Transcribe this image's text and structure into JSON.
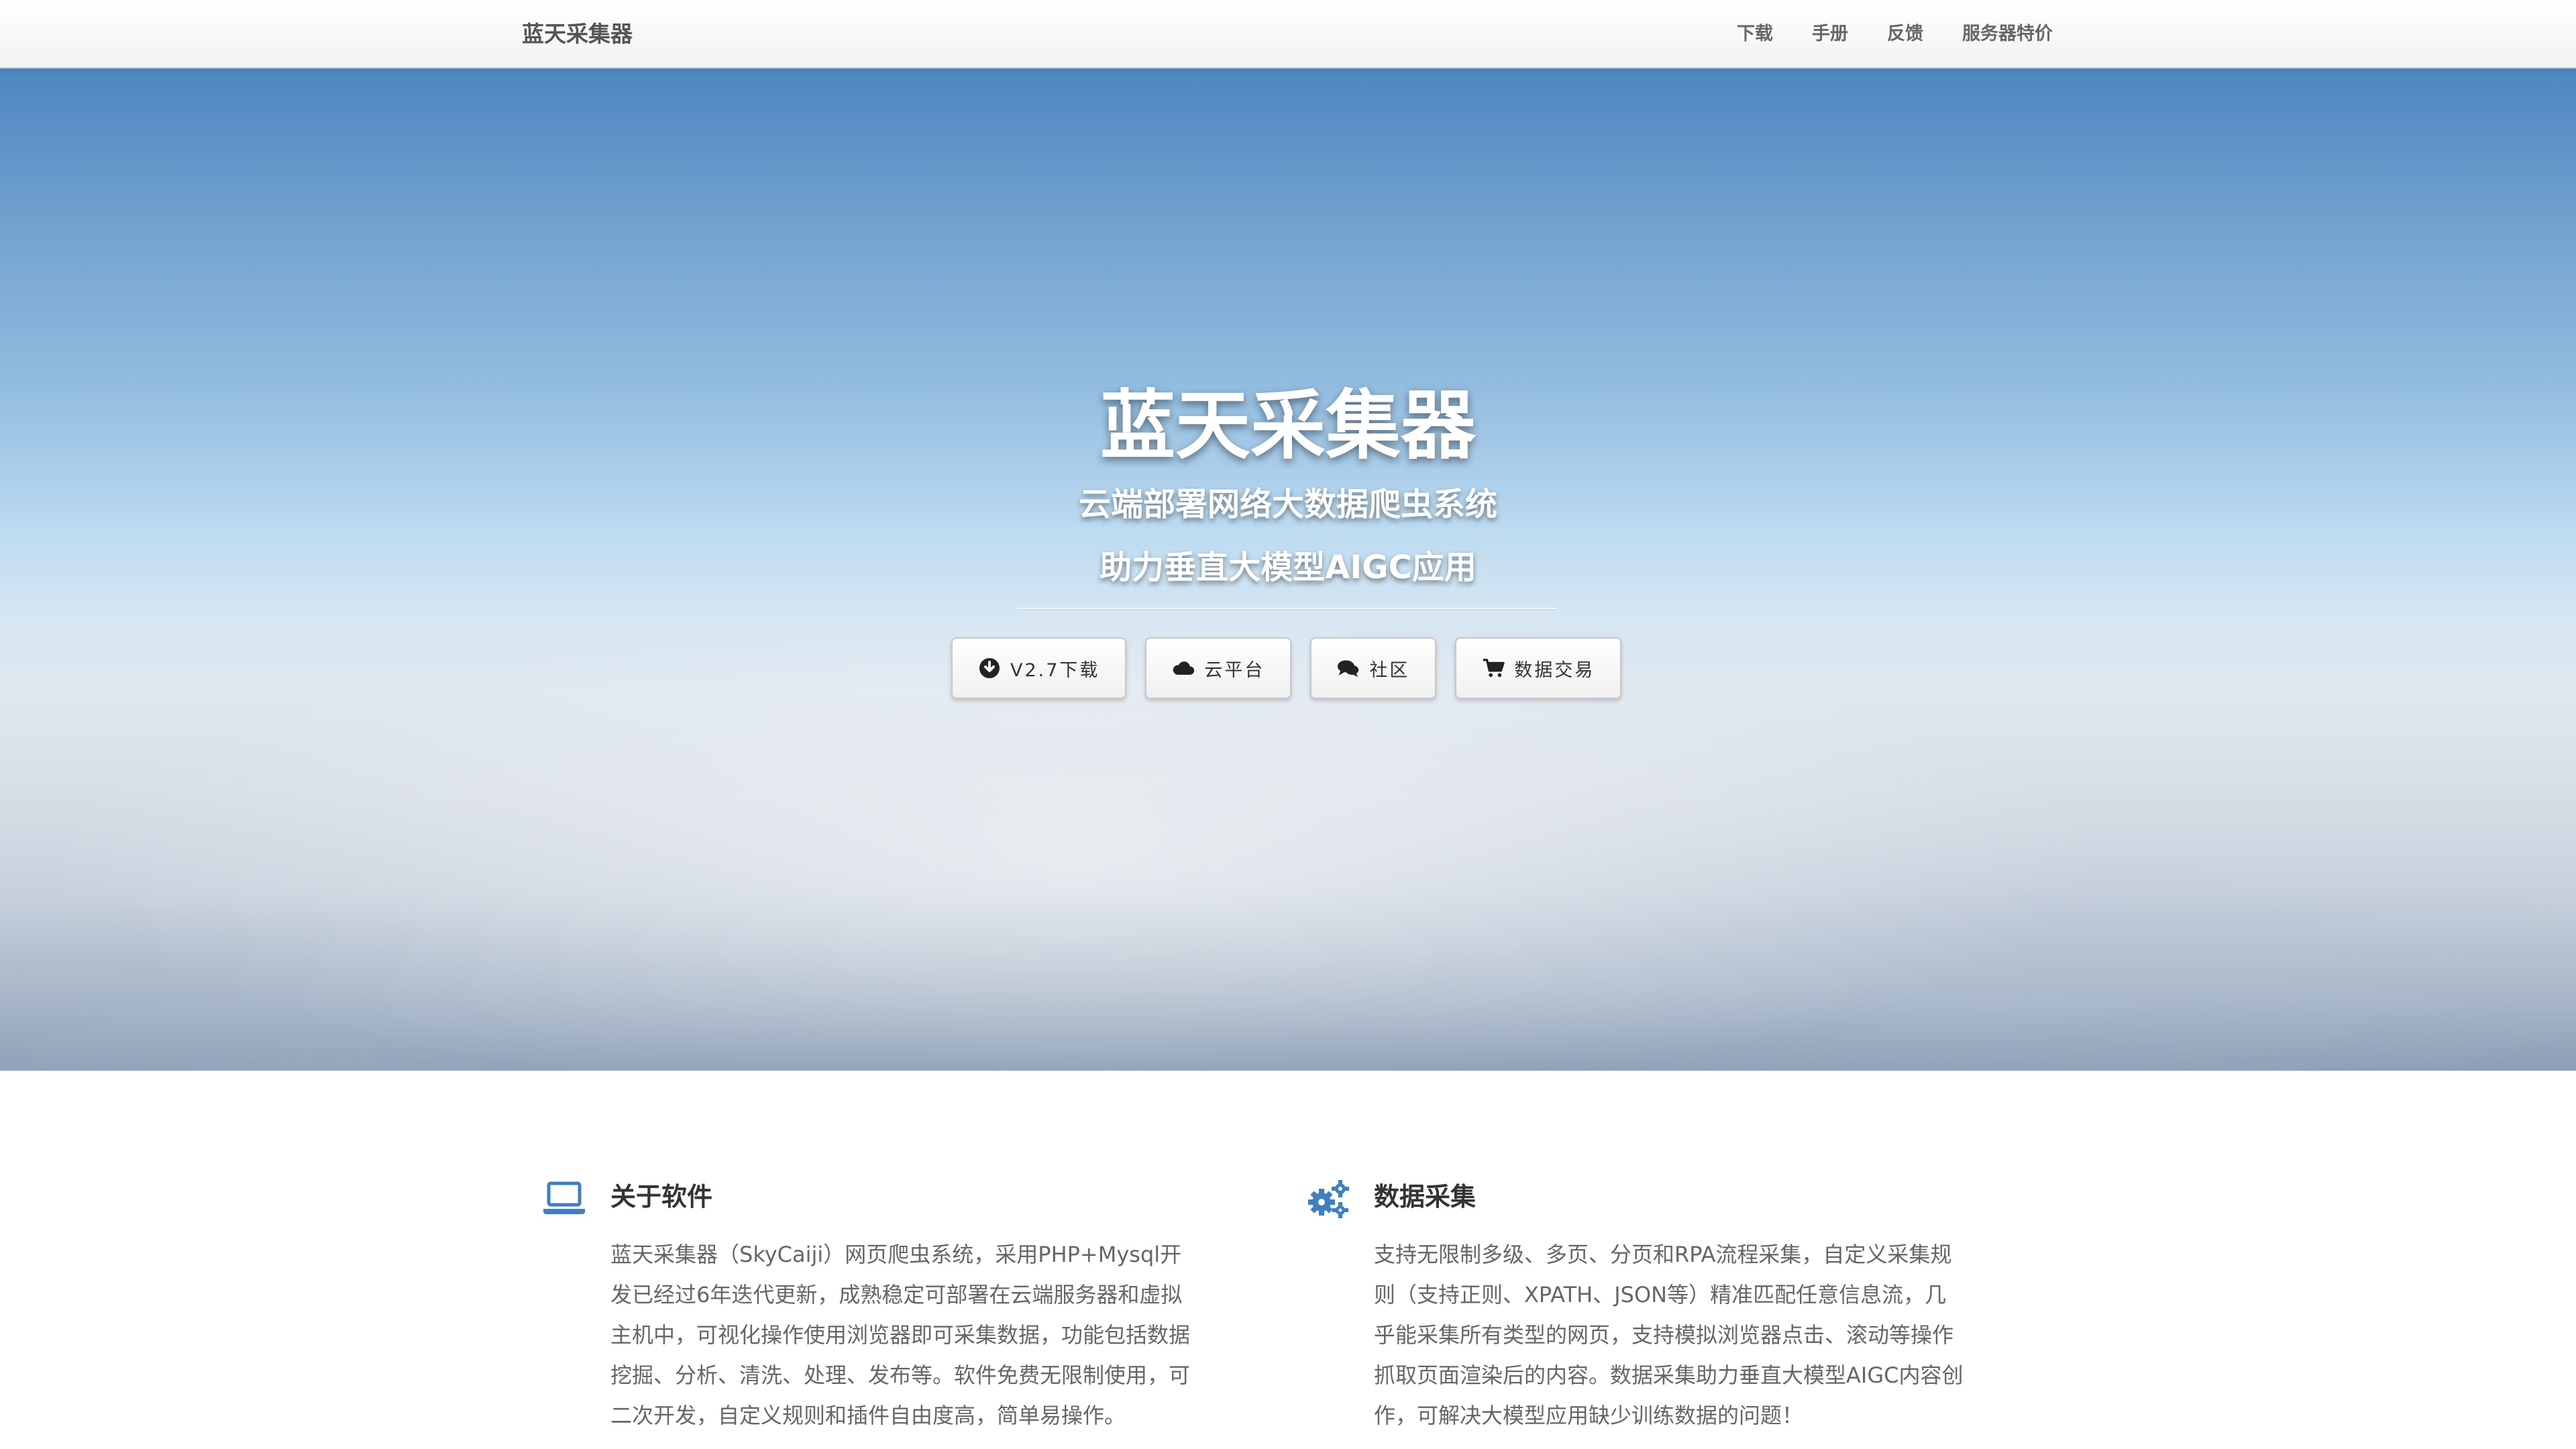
{
  "navbar": {
    "brand": "蓝天采集器",
    "items": [
      {
        "label": "下载"
      },
      {
        "label": "手册"
      },
      {
        "label": "反馈"
      },
      {
        "label": "服务器特价"
      }
    ]
  },
  "hero": {
    "title": "蓝天采集器",
    "subtitle_1": "云端部署网络大数据爬虫系统",
    "subtitle_2": "助力垂直大模型AIGC应用",
    "buttons": [
      {
        "label": "V2.7下载",
        "icon": "download-circle-icon"
      },
      {
        "label": "云平台",
        "icon": "cloud-icon"
      },
      {
        "label": "社区",
        "icon": "comments-icon"
      },
      {
        "label": "数据交易",
        "icon": "shopping-cart-icon"
      }
    ]
  },
  "features": [
    {
      "icon": "laptop-icon",
      "title": "关于软件",
      "text": "蓝天采集器（SkyCaiji）网页爬虫系统，采用PHP+Mysql开发已经过6年迭代更新，成熟稳定可部署在云端服务器和虚拟主机中，可视化操作使用浏览器即可采集数据，功能包括数据挖掘、分析、清洗、处理、发布等。软件免费无限制使用，可二次开发，自定义规则和插件自由度高，简单易操作。"
    },
    {
      "icon": "gears-icon",
      "title": "数据采集",
      "text": "支持无限制多级、多页、分页和RPA流程采集，自定义采集规则（支持正则、XPATH、JSON等）精准匹配任意信息流，几乎能采集所有类型的网页，支持模拟浏览器点击、滚动等操作抓取页面渲染后的内容。数据采集助力垂直大模型AIGC内容创作，可解决大模型应用缺少训练数据的问题！"
    }
  ],
  "colors": {
    "icon_blue": "#3f7fc1",
    "nav_text": "#666666",
    "body_text": "#666666"
  }
}
